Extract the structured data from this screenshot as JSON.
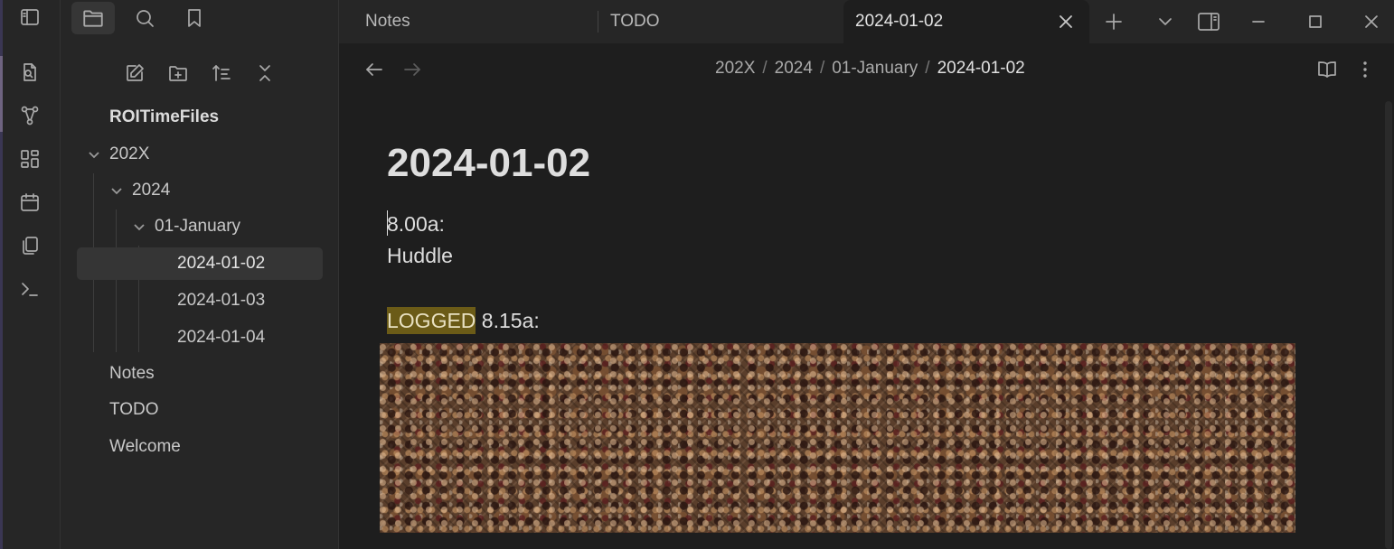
{
  "window": {
    "tabs": [
      {
        "label": "Notes"
      },
      {
        "label": "TODO"
      },
      {
        "label": "2024-01-02",
        "active": true
      }
    ]
  },
  "ribbon": {
    "icons": [
      "sidebar-toggle-icon",
      "quick-switcher-icon",
      "graph-icon",
      "canvas-icon",
      "calendar-icon",
      "templates-icon",
      "command-palette-icon"
    ]
  },
  "sidebar": {
    "vault_name": "ROITimeFiles",
    "tree": [
      {
        "label": "202X",
        "type": "folder"
      },
      {
        "label": "2024",
        "type": "folder"
      },
      {
        "label": "01-January",
        "type": "folder"
      },
      {
        "label": "2024-01-02",
        "type": "file",
        "selected": true
      },
      {
        "label": "2024-01-03",
        "type": "file"
      },
      {
        "label": "2024-01-04",
        "type": "file"
      },
      {
        "label": "Notes",
        "type": "file"
      },
      {
        "label": "TODO",
        "type": "file"
      },
      {
        "label": "Welcome",
        "type": "file"
      }
    ]
  },
  "breadcrumb": [
    "202X",
    "2024",
    "01-January",
    "2024-01-02"
  ],
  "breadcrumb_separator": "/",
  "note": {
    "title": "2024-01-02",
    "line1": "8.00a:",
    "line2": "Huddle",
    "logged_tag": "LOGGED",
    "line3_rest": " 8.15a:"
  },
  "colors": {
    "accent_highlight": "#6b5b17",
    "background": "#1e1e1e",
    "sidebar": "#262626"
  }
}
